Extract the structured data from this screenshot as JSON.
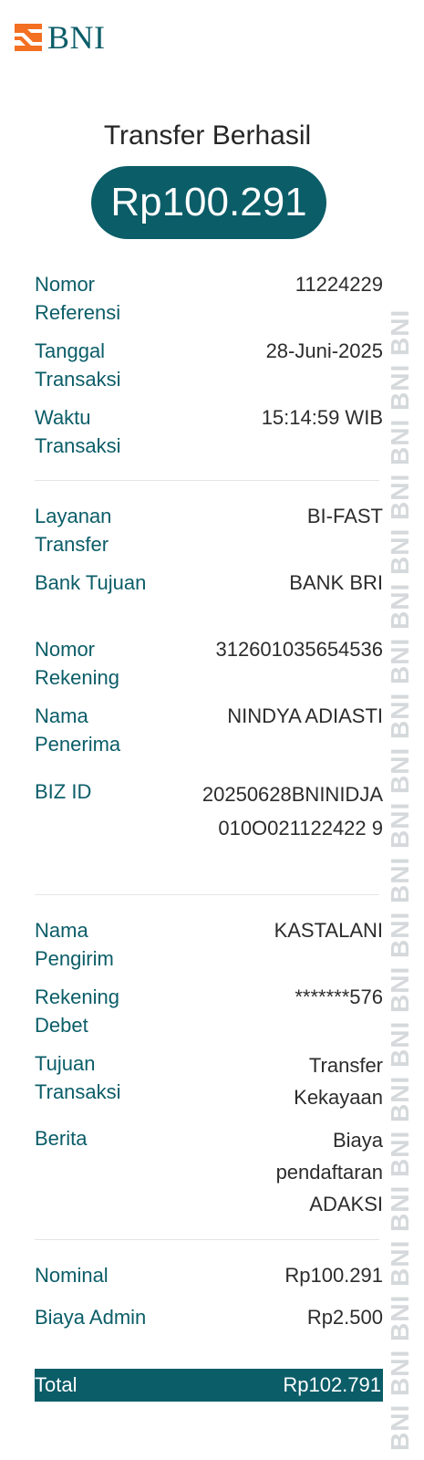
{
  "brand": {
    "name": "BNI",
    "color": "#0b5d68",
    "accent": "#f36f21"
  },
  "watermark": {
    "text": "BNI BNI BNI BNI BNI BNI BNI BNI BNI BNI BNI BNI BNI BNI BNI BNI BNI BNI BNI BNI BNI"
  },
  "header": {
    "title": "Transfer Berhasil",
    "amount": "Rp100.291"
  },
  "details": {
    "reference": {
      "label": "Nomor Referensi",
      "value": "11224229"
    },
    "date": {
      "label": "Tanggal Transaksi",
      "value": "28-Juni-2025"
    },
    "time": {
      "label": "Waktu Transaksi",
      "value": "15:14:59 WIB"
    },
    "service": {
      "label": "Layanan Transfer",
      "value": "BI-FAST"
    },
    "bank": {
      "label": "Bank Tujuan",
      "value": "BANK BRI"
    },
    "account": {
      "label": "Nomor Rekening",
      "value": "312601035654536"
    },
    "recipient": {
      "label": "Nama Penerima",
      "value": "NINDYA ADIASTI"
    },
    "biz_id": {
      "label": "BIZ ID",
      "value": "20250628BNINIDJA010O021122422 9"
    },
    "sender": {
      "label": "Nama Pengirim",
      "value": "KASTALANI"
    },
    "debit_account": {
      "label": "Rekening Debet",
      "value": "*******576"
    },
    "purpose": {
      "label": "Tujuan Transaksi",
      "value": "Transfer Kekayaan"
    },
    "message": {
      "label": "Berita",
      "value": "Biaya pendaftaran ADAKSI"
    },
    "nominal": {
      "label": "Nominal",
      "value": "Rp100.291"
    },
    "admin_fee": {
      "label": "Biaya Admin",
      "value": "Rp2.500"
    }
  },
  "total": {
    "label": "Total",
    "value": "Rp102.791"
  }
}
